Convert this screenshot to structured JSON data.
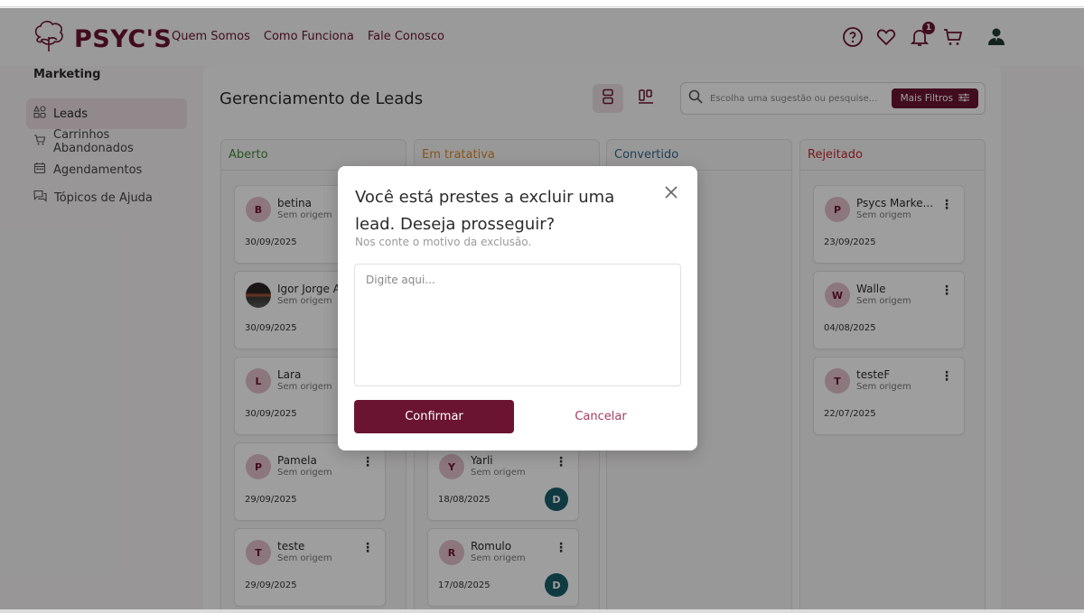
{
  "header": {
    "brand": "PSYC'S",
    "nav": [
      "Quem Somos",
      "Como Funciona",
      "Fale Conosco"
    ],
    "notification_count": "1",
    "icons": [
      "help-icon",
      "heart-icon",
      "bell-icon",
      "cart-icon",
      "user-icon"
    ]
  },
  "sidebar": {
    "title": "Marketing",
    "items": [
      {
        "label": "Leads",
        "icon": "leads-icon",
        "active": true
      },
      {
        "label": "Carrinhos Abandonados",
        "icon": "cart-icon"
      },
      {
        "label": "Agendamentos",
        "icon": "calendar-icon"
      },
      {
        "label": "Tópicos de Ajuda",
        "icon": "chat-icon"
      }
    ]
  },
  "main": {
    "title": "Gerenciamento de Leads",
    "search_placeholder": "Escolha uma sugestão ou pesquise...",
    "filter_button": "Mais Filtros"
  },
  "columns": [
    {
      "title": "Aberto",
      "color": "#3f8a3a",
      "cards": [
        {
          "initial": "B",
          "name": "betina",
          "origin": "Sem origem",
          "date": "30/09/2025"
        },
        {
          "initial": "",
          "name": "Igor Jorge A",
          "origin": "Sem origem",
          "date": "30/09/2025",
          "photo": true
        },
        {
          "initial": "L",
          "name": "Lara",
          "origin": "Sem origem",
          "date": "30/09/2025"
        },
        {
          "initial": "P",
          "name": "Pamela",
          "origin": "Sem origem",
          "date": "29/09/2025"
        },
        {
          "initial": "T",
          "name": "teste",
          "origin": "Sem origem",
          "date": "29/09/2025"
        }
      ]
    },
    {
      "title": "Em tratativa",
      "color": "#d88a2c",
      "cards": [
        {
          "initial": "Y",
          "name": "Yarli",
          "origin": "Sem origem",
          "date": "18/08/2025",
          "assignee": "D"
        },
        {
          "initial": "R",
          "name": "Romulo",
          "origin": "Sem origem",
          "date": "17/08/2025",
          "assignee": "D"
        }
      ]
    },
    {
      "title": "Convertido",
      "color": "#2c6a8a",
      "cards": []
    },
    {
      "title": "Rejeitado",
      "color": "#c0272d",
      "cards": [
        {
          "initial": "P",
          "name": "Psycs Marke...",
          "origin": "Sem origem",
          "date": "23/09/2025"
        },
        {
          "initial": "W",
          "name": "Walle",
          "origin": "Sem origem",
          "date": "04/08/2025"
        },
        {
          "initial": "T",
          "name": "testeF",
          "origin": "Sem origem",
          "date": "22/07/2025"
        }
      ]
    }
  ],
  "modal": {
    "title": "Você está prestes a excluir uma lead. Deseja prosseguir?",
    "subtitle": "Nos conte o motivo da exclusão.",
    "placeholder": "Digite aqui...",
    "confirm": "Confirmar",
    "cancel": "Cancelar"
  }
}
